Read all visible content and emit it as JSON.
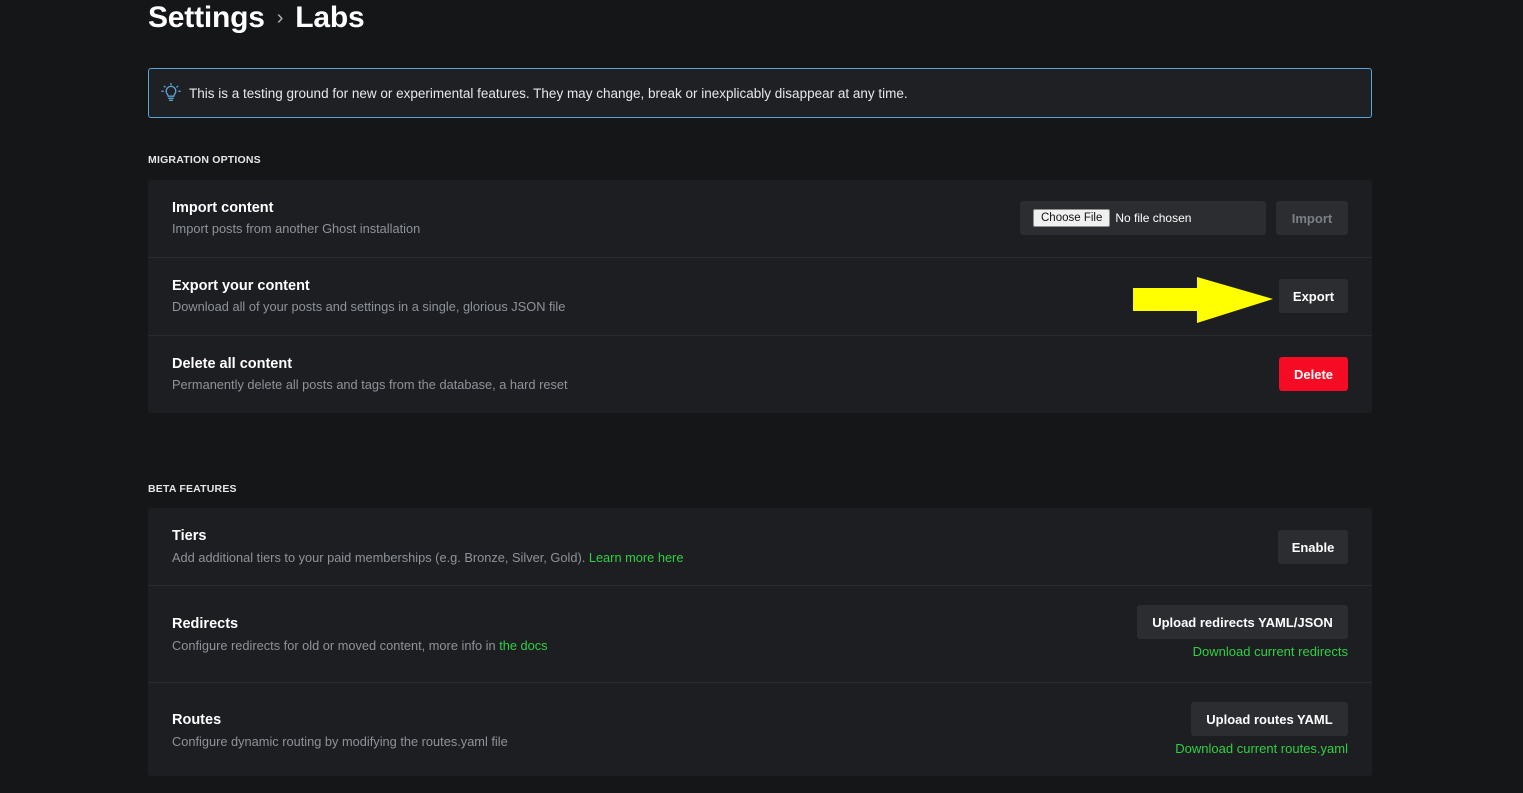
{
  "breadcrumb": {
    "parent": "Settings",
    "separator": "›",
    "current": "Labs"
  },
  "notice": {
    "icon": "lightbulb-icon",
    "text": "This is a testing ground for new or experimental features. They may change, break or inexplicably disappear at any time."
  },
  "migration": {
    "section_label": "MIGRATION OPTIONS",
    "import": {
      "title": "Import content",
      "desc": "Import posts from another Ghost installation",
      "choose_file_label": "Choose File",
      "file_status": "No file chosen",
      "button": "Import"
    },
    "export": {
      "title": "Export your content",
      "desc": "Download all of your posts and settings in a single, glorious JSON file",
      "button": "Export"
    },
    "delete": {
      "title": "Delete all content",
      "desc": "Permanently delete all posts and tags from the database, a hard reset",
      "button": "Delete"
    }
  },
  "beta": {
    "section_label": "BETA FEATURES",
    "tiers": {
      "title": "Tiers",
      "desc": "Add additional tiers to your paid memberships (e.g. Bronze, Silver, Gold).",
      "link": "Learn more here",
      "button": "Enable"
    },
    "redirects": {
      "title": "Redirects",
      "desc": "Configure redirects for old or moved content, more info in",
      "link": "the docs",
      "button": "Upload redirects YAML/JSON",
      "download": "Download current redirects"
    },
    "routes": {
      "title": "Routes",
      "desc": "Configure dynamic routing by modifying the routes.yaml file",
      "button": "Upload routes YAML",
      "download": "Download current routes.yaml"
    }
  },
  "colors": {
    "background": "#151618",
    "card": "#1d1e22",
    "accent_green": "#30cf43",
    "danger_red": "#f50b23",
    "notice_border": "#5aa5d6",
    "annotation_arrow": "#ffff00"
  }
}
